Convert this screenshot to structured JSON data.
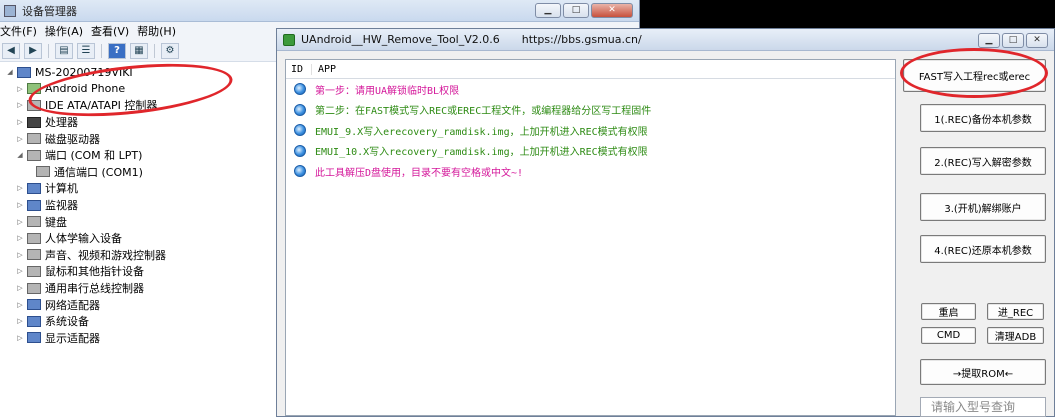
{
  "device_manager": {
    "title": "设备管理器",
    "menu": [
      "文件(F)",
      "操作(A)",
      "查看(V)",
      "帮助(H)"
    ],
    "root": "MS-20200719VIKI",
    "items": [
      {
        "label": "Android Phone",
        "expanded": false
      },
      {
        "label": "IDE ATA/ATAPI 控制器",
        "expanded": false
      },
      {
        "label": "处理器",
        "expanded": false
      },
      {
        "label": "磁盘驱动器",
        "expanded": false
      },
      {
        "label": "端口 (COM 和 LPT)",
        "expanded": true,
        "child": "通信端口 (COM1)"
      },
      {
        "label": "计算机",
        "expanded": false
      },
      {
        "label": "监视器",
        "expanded": false
      },
      {
        "label": "键盘",
        "expanded": false
      },
      {
        "label": "人体学输入设备",
        "expanded": false
      },
      {
        "label": "声音、视频和游戏控制器",
        "expanded": false
      },
      {
        "label": "鼠标和其他指针设备",
        "expanded": false
      },
      {
        "label": "通用串行总线控制器",
        "expanded": false
      },
      {
        "label": "网络适配器",
        "expanded": false
      },
      {
        "label": "系统设备",
        "expanded": false
      },
      {
        "label": "显示适配器",
        "expanded": false
      }
    ]
  },
  "tool": {
    "title": "UAndroid__HW_Remove_Tool_V2.0.6",
    "url": "https://bbs.gsmua.cn/",
    "columns": {
      "id": "ID",
      "app": "APP"
    },
    "rows": [
      {
        "text": "第一步：请用UA解锁临时BL权限",
        "color": "magenta"
      },
      {
        "text": "第二步：在FAST模式写入REC或EREC工程文件，或编程器给分区写工程固件",
        "color": "green"
      },
      {
        "text": "EMUI_9.X写入erecovery_ramdisk.img，上加开机进入REC模式有权限",
        "color": "green"
      },
      {
        "text": "EMUI_10.X写入recovery_ramdisk.img，上加开机进入REC模式有权限",
        "color": "green"
      },
      {
        "text": "此工具解压D盘使用，目录不要有空格或中文~!",
        "color": "magenta"
      }
    ],
    "buttons": {
      "fast_write": "FAST写入工程rec或erec",
      "backup": "1(.REC)备份本机参数",
      "write_decrypt": "2.(REC)写入解密参数",
      "unbind": "3.(开机)解绑账户",
      "restore": "4.(REC)还原本机参数",
      "reboot": "重启",
      "enter_rec": "进_REC",
      "cmd": "CMD",
      "clean_adb": "清理ADB",
      "extract_rom": "→提取ROM←"
    },
    "search_placeholder": "请输入型号查询"
  },
  "colors": {
    "magenta": "#d4179a",
    "green": "#2e8b14",
    "annotation": "#e0262b"
  }
}
